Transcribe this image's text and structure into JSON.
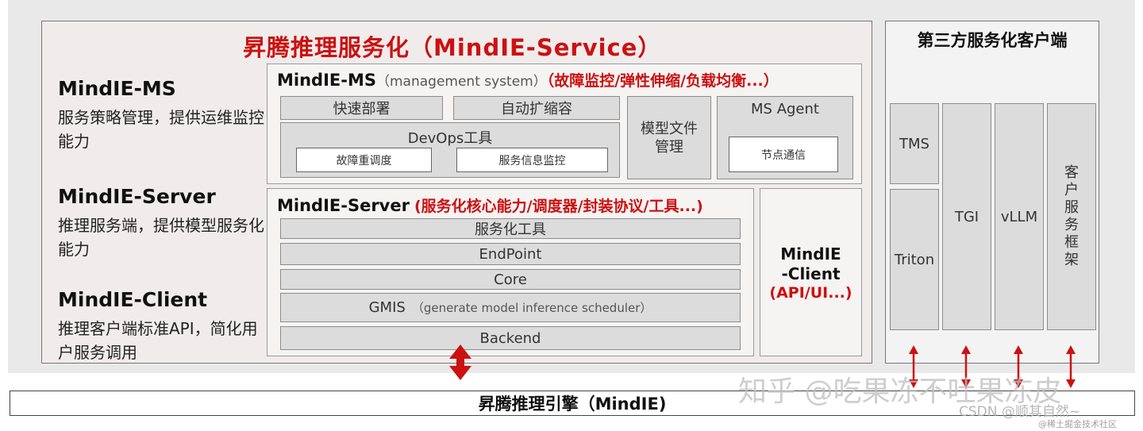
{
  "main_title": "昇腾推理服务化（MindIE-Service）",
  "left": [
    {
      "title": "MindIE-MS",
      "desc": "服务策略管理，提供运维监控能力"
    },
    {
      "title": "MindIE-Server",
      "desc": "推理服务端，提供模型服务化能力"
    },
    {
      "title": "MindIE-Client",
      "desc": "推理客户端标准API，简化用户服务调用"
    }
  ],
  "ms": {
    "title": "MindIE-MS",
    "subtitle": "（management system）",
    "features": "（故障监控/弹性伸缩/负载均衡...）",
    "deploy": "快速部署",
    "autoscale": "自动扩缩容",
    "devops": "DevOps工具",
    "fault_sched": "故障重调度",
    "info_monitor": "服务信息监控",
    "model_file": "模型文件管理",
    "agent": "MS Agent",
    "node_comm": "节点通信"
  },
  "server": {
    "title": "MindIE-Server",
    "features": "(服务化核心能力/调度器/封装协议/工具...)",
    "layers": [
      {
        "label": "服务化工具"
      },
      {
        "label": "EndPoint"
      },
      {
        "label": "Core"
      },
      {
        "label": "GMIS",
        "sub": "（generate model inference scheduler）"
      },
      {
        "label": "Backend"
      }
    ]
  },
  "client": {
    "line1": "MindIE",
    "line2": "-Client",
    "line3": "(API/UI...)"
  },
  "third_party": {
    "title": "第三方服务化客户端",
    "tms": "TMS",
    "triton": "Triton",
    "tgi": "TGI",
    "vllm": "vLLM",
    "framework": "客户服务框架"
  },
  "engine": "昇腾推理引擎（MindIE)",
  "watermark": "知乎 @吃果冻不吐果冻皮",
  "csdn": "CSDN @顺其自然~",
  "juejin": "@稀土掘金技术社区",
  "colors": {
    "red": "#cc1111",
    "arrow": "#cc1111"
  }
}
